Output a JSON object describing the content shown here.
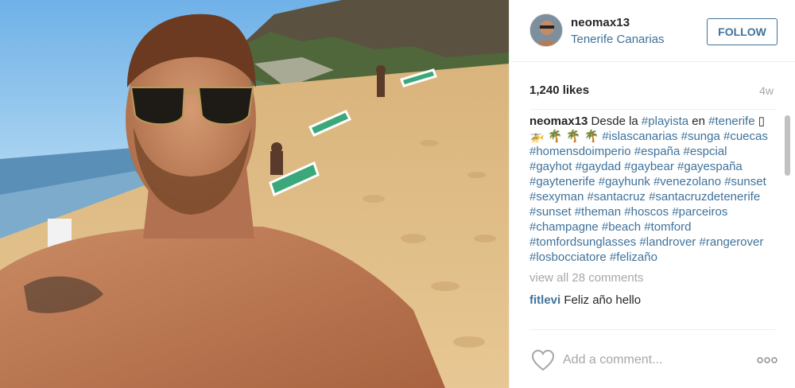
{
  "post": {
    "username": "neomax13",
    "location": "Tenerife Canarias",
    "follow_label": "FOLLOW",
    "likes": "1,240 likes",
    "age": "4w",
    "caption_user": "neomax13",
    "caption_segments": [
      {
        "text": "Desde la ",
        "tag": false
      },
      {
        "text": "#playista",
        "tag": true
      },
      {
        "text": " en ",
        "tag": false
      },
      {
        "text": "#tenerife",
        "tag": true
      },
      {
        "text": " ▯🚁 🌴 🌴 🌴 ",
        "tag": false
      },
      {
        "text": "#islascanarias",
        "tag": true
      },
      {
        "text": " ",
        "tag": false
      },
      {
        "text": "#sunga",
        "tag": true
      },
      {
        "text": " ",
        "tag": false
      },
      {
        "text": "#cuecas",
        "tag": true
      },
      {
        "text": " ",
        "tag": false
      },
      {
        "text": "#homensdoimperio",
        "tag": true
      },
      {
        "text": " ",
        "tag": false
      },
      {
        "text": "#españa",
        "tag": true
      },
      {
        "text": " ",
        "tag": false
      },
      {
        "text": "#espcial",
        "tag": true
      },
      {
        "text": " ",
        "tag": false
      },
      {
        "text": "#gayhot",
        "tag": true
      },
      {
        "text": " ",
        "tag": false
      },
      {
        "text": "#gaydad",
        "tag": true
      },
      {
        "text": " ",
        "tag": false
      },
      {
        "text": "#gaybear",
        "tag": true
      },
      {
        "text": " ",
        "tag": false
      },
      {
        "text": "#gayespaña",
        "tag": true
      },
      {
        "text": " ",
        "tag": false
      },
      {
        "text": "#gaytenerife",
        "tag": true
      },
      {
        "text": " ",
        "tag": false
      },
      {
        "text": "#gayhunk",
        "tag": true
      },
      {
        "text": " ",
        "tag": false
      },
      {
        "text": "#venezolano",
        "tag": true
      },
      {
        "text": " ",
        "tag": false
      },
      {
        "text": "#sunset",
        "tag": true
      },
      {
        "text": " ",
        "tag": false
      },
      {
        "text": "#sexyman",
        "tag": true
      },
      {
        "text": " ",
        "tag": false
      },
      {
        "text": "#santacruz",
        "tag": true
      },
      {
        "text": " ",
        "tag": false
      },
      {
        "text": "#santacruzdetenerife",
        "tag": true
      },
      {
        "text": " ",
        "tag": false
      },
      {
        "text": "#sunset",
        "tag": true
      },
      {
        "text": " ",
        "tag": false
      },
      {
        "text": "#theman",
        "tag": true
      },
      {
        "text": " ",
        "tag": false
      },
      {
        "text": "#hoscos",
        "tag": true
      },
      {
        "text": " ",
        "tag": false
      },
      {
        "text": "#parceiros",
        "tag": true
      },
      {
        "text": " ",
        "tag": false
      },
      {
        "text": "#champagne",
        "tag": true
      },
      {
        "text": " ",
        "tag": false
      },
      {
        "text": "#beach",
        "tag": true
      },
      {
        "text": " ",
        "tag": false
      },
      {
        "text": "#tomford",
        "tag": true
      },
      {
        "text": " ",
        "tag": false
      },
      {
        "text": "#tomfordsunglasses",
        "tag": true
      },
      {
        "text": " ",
        "tag": false
      },
      {
        "text": "#landrover",
        "tag": true
      },
      {
        "text": " ",
        "tag": false
      },
      {
        "text": "#rangerover",
        "tag": true
      },
      {
        "text": " ",
        "tag": false
      },
      {
        "text": "#losbocciatore",
        "tag": true
      },
      {
        "text": " ",
        "tag": false
      },
      {
        "text": "#felizaño",
        "tag": true
      }
    ],
    "view_all_label": "view all 28 comments",
    "next_comment": {
      "user": "fitlevi",
      "text": "Feliz año hello"
    },
    "add_comment_placeholder": "Add a comment...",
    "icons": {
      "like": "heart-icon",
      "options": "more-options-icon"
    },
    "colors": {
      "link": "#3f729b",
      "muted": "#a5a7aa",
      "text": "#262626"
    }
  }
}
